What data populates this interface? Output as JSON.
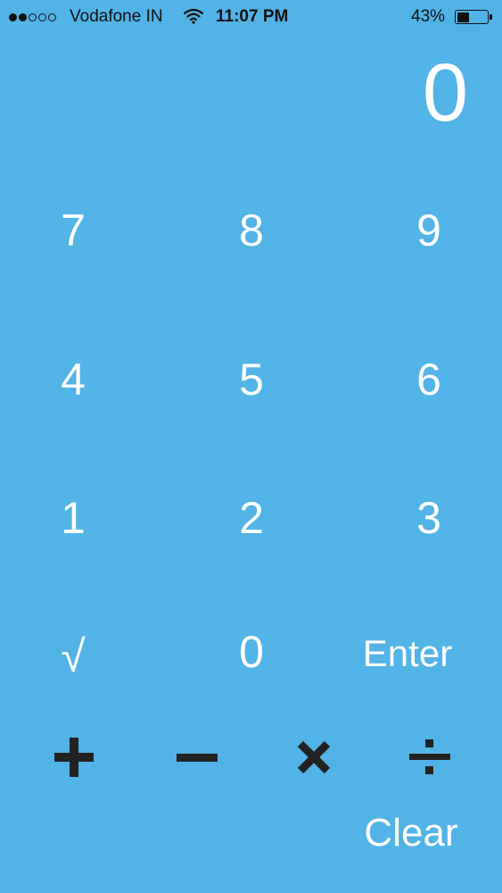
{
  "status_bar": {
    "signal_dots": [
      true,
      true,
      false,
      false,
      false
    ],
    "carrier": "Vodafone IN",
    "time": "11:07 PM",
    "battery_percent": "43%",
    "battery_level": 0.43,
    "wifi_icon": "wifi-icon"
  },
  "display": {
    "value": "0"
  },
  "keypad": {
    "row1": [
      "7",
      "8",
      "9"
    ],
    "row2": [
      "4",
      "5",
      "6"
    ],
    "row3": [
      "1",
      "2",
      "3"
    ],
    "row4": {
      "sqrt": "√",
      "zero": "0",
      "enter": "Enter"
    },
    "operators": {
      "plus": "plus-icon",
      "minus": "minus-icon",
      "multiply": "multiply-icon",
      "divide": "divide-icon"
    },
    "clear": "Clear"
  },
  "colors": {
    "background": "#52b3e6",
    "key_text": "#ffffff",
    "operator": "#222222",
    "status_text": "#111111"
  }
}
